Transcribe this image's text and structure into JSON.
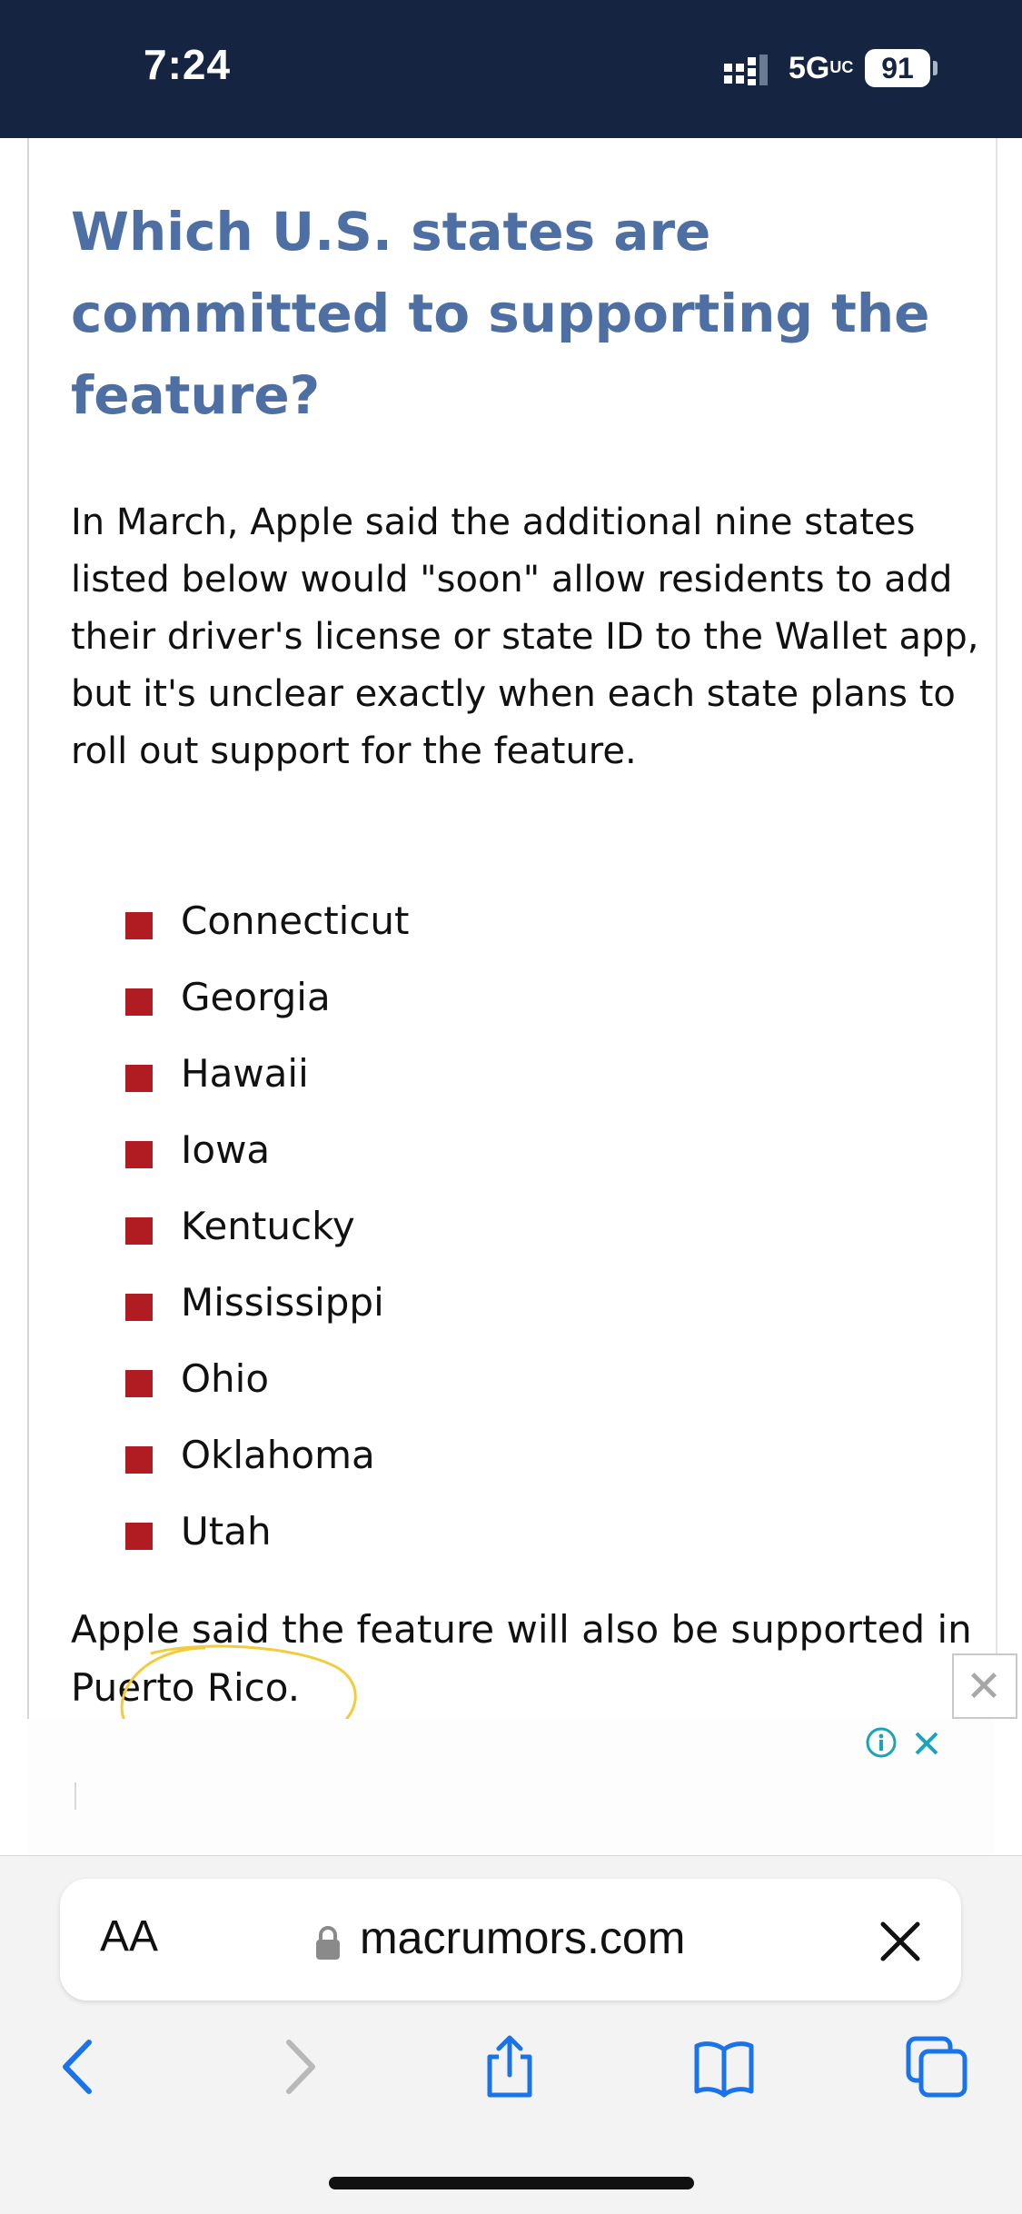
{
  "status_bar": {
    "time": "7:24",
    "network": "5G UC",
    "network_label": "5G",
    "network_suffix": "UC",
    "battery": "91",
    "background": "#152440"
  },
  "article": {
    "heading": "Which U.S. states are committed to supporting the feature?",
    "paragraph": "In March, Apple said the additional nine states listed below would \"soon\" allow residents to add their driver's license or state ID to the Wallet app, but it's unclear exactly when each state plans to roll out support for the feature.",
    "states": [
      "Connecticut",
      "Georgia",
      "Hawaii",
      "Iowa",
      "Kentucky",
      "Mississippi",
      "Ohio",
      "Oklahoma",
      "Utah"
    ],
    "closing_prefix": "Apple said the feature will also be supported in ",
    "closing_highlight": "Puerto Rico.",
    "heading_color": "#4d6fa3",
    "bullet_color": "#b01c22",
    "highlight_circle_color": "#f2cc3a"
  },
  "ad": {
    "icons": [
      "close-icon",
      "info-icon",
      "close-icon"
    ]
  },
  "browser": {
    "aa_label": "AA",
    "domain": "macrumors.com",
    "icons": [
      "lock-icon",
      "close-icon",
      "back-icon",
      "forward-icon",
      "share-icon",
      "bookmarks-icon",
      "tabs-icon"
    ],
    "accent": "#1a73e8"
  }
}
